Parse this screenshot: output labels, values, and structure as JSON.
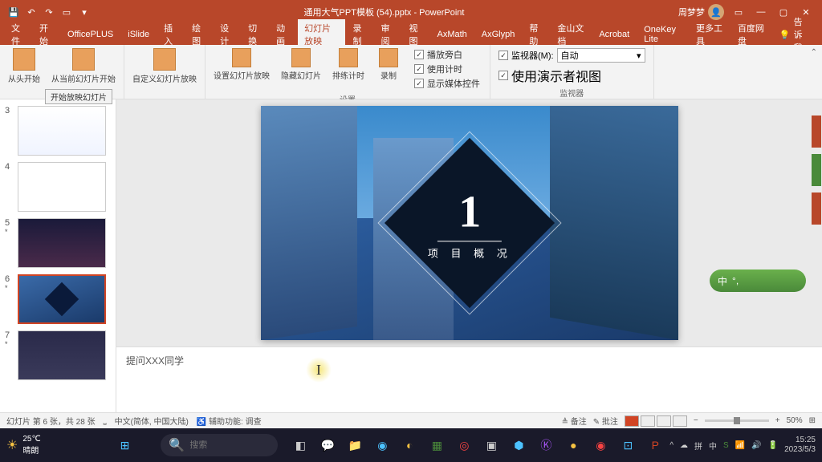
{
  "titlebar": {
    "doc_title": "通用大气PPT模板 (54).pptx - PowerPoint",
    "user_name": "周梦梦"
  },
  "menu": {
    "items": [
      "文件",
      "开始",
      "OfficePLUS",
      "iSlide",
      "插入",
      "绘图",
      "设计",
      "切换",
      "动画",
      "幻灯片放映",
      "录制",
      "审阅",
      "视图",
      "AxMath",
      "AxGlyph",
      "帮助",
      "金山文档",
      "Acrobat",
      "OneKey Lite",
      "更多工具",
      "百度网盘"
    ],
    "active_index": 9,
    "tell_me": "告诉我"
  },
  "ribbon": {
    "from_beginning": "从头开始",
    "from_current": "从当前幻灯片开始",
    "custom": "自定义幻灯片放映",
    "setup": "设置幻灯片放映",
    "hide": "隐藏幻灯片",
    "rehearse": "排练计时",
    "record": "录制",
    "play_narration": "播放旁白",
    "use_timings": "使用计时",
    "show_media": "显示媒体控件",
    "monitor_label": "监视器(M):",
    "monitor_value": "自动",
    "presenter_view": "使用演示者视图",
    "group_setup": "设置",
    "group_monitor": "监视器",
    "tooltip": "开始放映幻灯片"
  },
  "thumbs": [
    {
      "num": "3",
      "star": ""
    },
    {
      "num": "4",
      "star": ""
    },
    {
      "num": "5",
      "star": "*"
    },
    {
      "num": "6",
      "star": "*"
    },
    {
      "num": "7",
      "star": "*"
    }
  ],
  "slide": {
    "big_number": "1",
    "subtitle": "项 目 概 况"
  },
  "notes": {
    "text": "提问XXX同学"
  },
  "ime": {
    "label": "中"
  },
  "status": {
    "slide_info": "幻灯片 第 6 张，共 28 张",
    "lang": "中文(简体, 中国大陆)",
    "accessibility": "辅助功能: 调查",
    "notes_btn": "备注",
    "comments_btn": "批注",
    "zoom": "50%"
  },
  "taskbar": {
    "temp": "25℃",
    "weather": "晴朗",
    "search_placeholder": "搜索",
    "time": "15:25",
    "date": "2023/5/3"
  }
}
